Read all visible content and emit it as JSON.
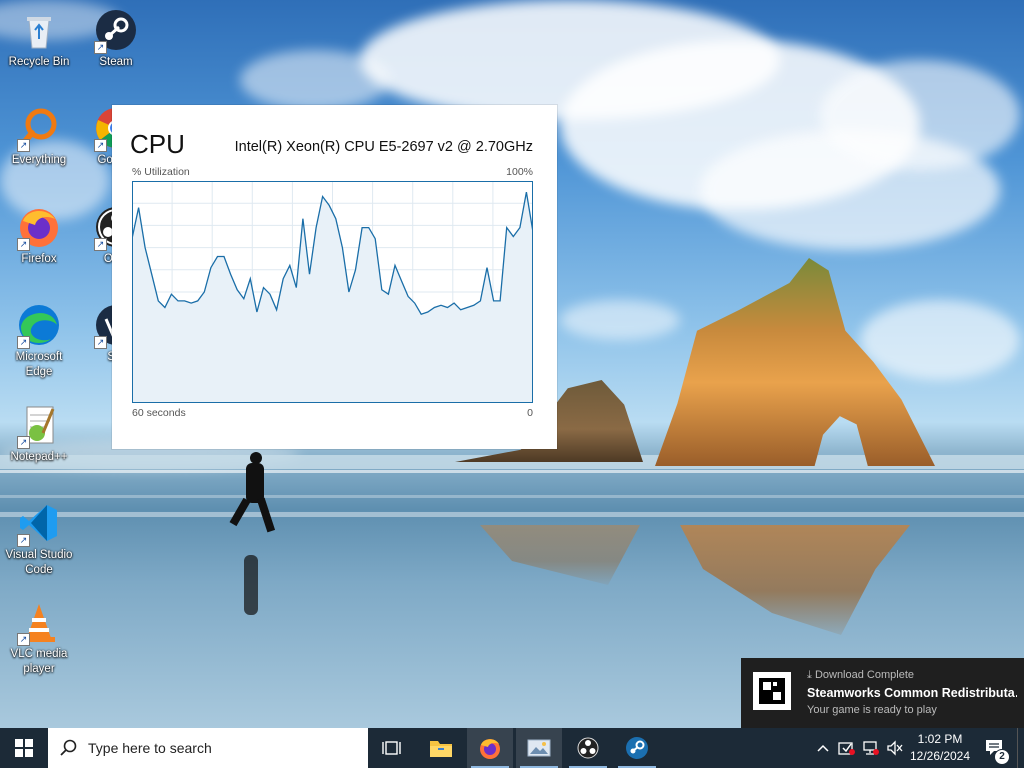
{
  "desktop": {
    "icons": [
      {
        "label": "Recycle Bin",
        "icon": "recycle-bin-icon"
      },
      {
        "label": "Steam",
        "icon": "steam-icon"
      },
      {
        "label": "Everything",
        "icon": "everything-search-icon"
      },
      {
        "label": "Go Chr",
        "icon": "google-chrome-icon"
      },
      {
        "label": "Firefox",
        "icon": "firefox-icon"
      },
      {
        "label": "OBS",
        "icon": "obs-studio-icon"
      },
      {
        "label": "Microsoft Edge",
        "icon": "edge-icon"
      },
      {
        "label": "Ste",
        "icon": "steam-icon"
      },
      {
        "label": "Notepad++",
        "icon": "notepad-plus-plus-icon"
      },
      {
        "label": "Visual Studio Code",
        "icon": "vscode-icon"
      },
      {
        "label": "VLC media player",
        "icon": "vlc-icon"
      }
    ]
  },
  "cpu_widget": {
    "title": "CPU",
    "model": "Intel(R) Xeon(R) CPU E5-2697 v2 @ 2.70GHz",
    "y_label": "% Utilization",
    "y_max_label": "100%",
    "x_left_label": "60 seconds",
    "x_right_label": "0",
    "line_color": "#1a6ea8",
    "fill_color": "#e8f1f8"
  },
  "chart_data": {
    "type": "area",
    "title": "CPU",
    "ylabel": "% Utilization",
    "xlabel": "",
    "ylim": [
      0,
      100
    ],
    "xlim": [
      60,
      0
    ],
    "grid": true,
    "series": [
      {
        "values": [
          74,
          88,
          70,
          58,
          46,
          43,
          49,
          46,
          46,
          45,
          46,
          50,
          61,
          66,
          66,
          58,
          51,
          47,
          56,
          41,
          52,
          49,
          42,
          56,
          62,
          52,
          83,
          58,
          79,
          93,
          89,
          83,
          70,
          50,
          60,
          79,
          79,
          74,
          51,
          49,
          62,
          55,
          48,
          45,
          40,
          41,
          43,
          44,
          43,
          45,
          42,
          43,
          44,
          46,
          61,
          46,
          46,
          79,
          75,
          79,
          95,
          77
        ]
      }
    ]
  },
  "notification": {
    "header": "Download Complete",
    "title": "Steamworks Common Redistributa…",
    "body": "Your game is ready to play"
  },
  "taskbar": {
    "search_placeholder": "Type here to search",
    "pinned": [
      {
        "name": "task-view",
        "icon": "task-view-icon"
      },
      {
        "name": "file-explorer",
        "icon": "folder-icon"
      },
      {
        "name": "firefox",
        "icon": "firefox-icon"
      },
      {
        "name": "photos",
        "icon": "image-app-icon"
      },
      {
        "name": "obs",
        "icon": "obs-studio-icon"
      },
      {
        "name": "steam",
        "icon": "steam-icon"
      }
    ],
    "time": "1:02 PM",
    "date": "12/26/2024",
    "notification_count": "2"
  }
}
